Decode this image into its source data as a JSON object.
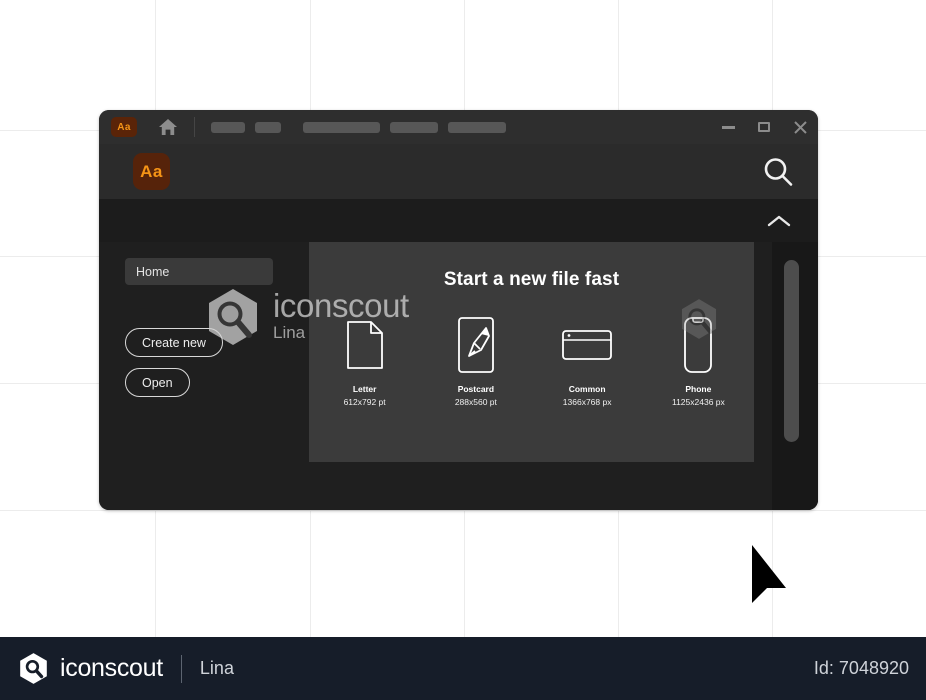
{
  "background": {
    "grid_color": "#ececec",
    "vertical_lines": [
      155,
      310,
      464,
      618,
      772
    ],
    "horizontal_lines": [
      130,
      256,
      383,
      510
    ]
  },
  "app_window": {
    "titlebar": {
      "app_badge_label": "Aa",
      "home_icon": "home-icon",
      "menu_chips": [
        34,
        26,
        77,
        48,
        58
      ],
      "window_controls": {
        "minimize": "minimize-icon",
        "maximize": "maximize-icon",
        "close": "close-icon"
      }
    },
    "searchbar": {
      "app_badge_label": "Aa",
      "search_icon": "search-icon"
    },
    "collapse_row": {
      "chevron_icon": "chevron-up-icon"
    },
    "sidebar": {
      "home_label": "Home",
      "create_new_label": "Create new",
      "open_label": "Open"
    },
    "main": {
      "title": "Start a new file fast",
      "files": [
        {
          "name": "Letter",
          "size": "612x792 pt",
          "icon": "document-icon"
        },
        {
          "name": "Postcard",
          "size": "288x560 pt",
          "icon": "paintbrush-icon"
        },
        {
          "name": "Common",
          "size": "1366x768 px",
          "icon": "browser-window-icon"
        },
        {
          "name": "Phone",
          "size": "1125x2436 px",
          "icon": "phone-icon"
        }
      ]
    },
    "scrollbar": {
      "orientation": "vertical"
    }
  },
  "watermark": {
    "brand": "iconscout",
    "author": "Lina"
  },
  "footer": {
    "brand": "iconscout",
    "author": "Lina",
    "id_label": "Id: 7048920",
    "background": "#161d29"
  },
  "colors": {
    "window_bg": "#232323",
    "titlebar_bg": "#2e2e2e",
    "searchbar_bg": "#2b2b2b",
    "collapse_bg": "#1c1c1c",
    "body_bg": "#1f1f1f",
    "panel_bg": "#3b3b3b",
    "badge_bg": "#56230a",
    "badge_fg": "#f59416"
  }
}
